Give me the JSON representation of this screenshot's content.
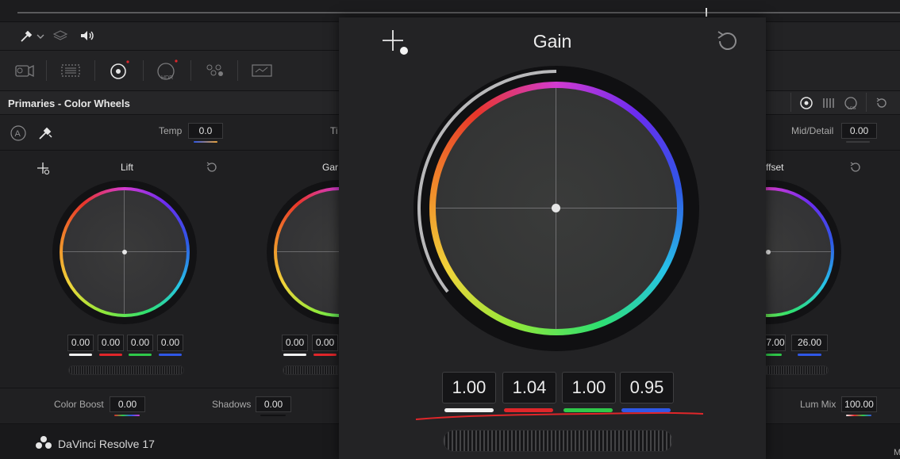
{
  "app": {
    "name": "DaVinci Resolve 17"
  },
  "panel": {
    "title": "Primaries - Color Wheels"
  },
  "params_top": {
    "temp_label": "Temp",
    "temp_value": "0.0",
    "tint_label_partial": "Ti",
    "mid_detail_label": "Mid/Detail",
    "mid_detail_value": "0.00"
  },
  "params_bottom": {
    "color_boost_label": "Color Boost",
    "color_boost_value": "0.00",
    "shadows_label": "Shadows",
    "shadows_value": "0.00",
    "lum_mix_label": "Lum Mix",
    "lum_mix_value": "100.00",
    "edge_partial": "M"
  },
  "wheels": {
    "lift": {
      "label": "Lift",
      "values": [
        "0.00",
        "0.00",
        "0.00",
        "0.00"
      ]
    },
    "gamma_partial": {
      "label": "Gar",
      "values": [
        "0.00",
        "0.00"
      ]
    },
    "offset_partial": {
      "label": "ffset",
      "values": [
        "7.00",
        "26.00"
      ]
    }
  },
  "gain_popup": {
    "label": "Gain",
    "values": [
      "1.00",
      "1.04",
      "1.00",
      "0.95"
    ]
  },
  "channel_colors": {
    "master": "#f2f2f2",
    "red": "#e0262a",
    "green": "#2fc84a",
    "blue": "#2f57e6"
  },
  "annotation": {
    "color": "#e0262a"
  },
  "icons": [
    "eyedropper-icon",
    "chevron-down-icon",
    "layers-icon",
    "speaker-icon",
    "camera-raw-icon",
    "color-match-icon",
    "primaries-icon",
    "hdr-icon",
    "rgb-mixer-icon",
    "motion-effects-icon",
    "color-wheels-mode-icon",
    "primaries-bars-icon",
    "log-wheels-icon",
    "reset-icon",
    "auto-balance-icon",
    "picker-icon",
    "crosshair-icon",
    "davinci-logo-icon"
  ]
}
